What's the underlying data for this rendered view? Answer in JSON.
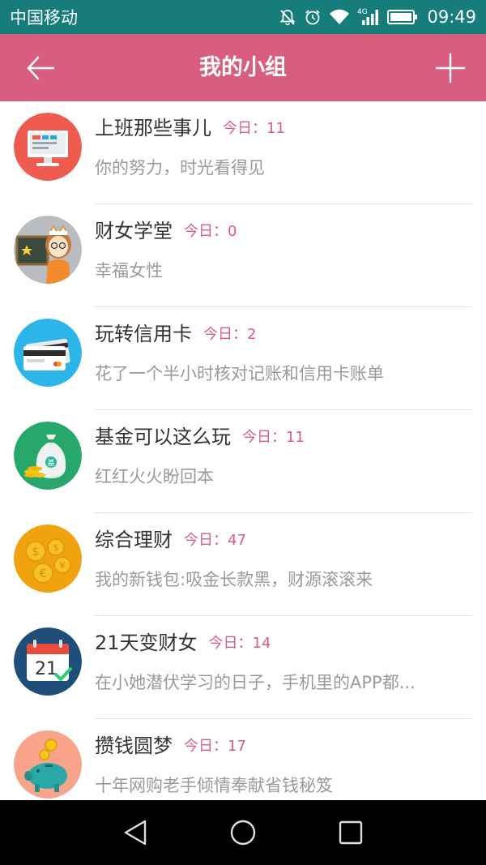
{
  "status_bar": {
    "carrier": "中国移动",
    "network": "4G",
    "time": "09:49",
    "icons": [
      "mute-icon",
      "alarm-icon",
      "wifi-icon",
      "signal-icon",
      "battery-icon"
    ]
  },
  "header": {
    "title": "我的小组",
    "back_icon": "arrow-left-icon",
    "add_icon": "plus-icon",
    "color": "#d95d7e"
  },
  "groups": [
    {
      "name": "上班那些事儿",
      "today": "今日：11",
      "desc": "你的努力，时光看得见",
      "icon": "monitor-icon"
    },
    {
      "name": "财女学堂",
      "today": "今日：0",
      "desc": "幸福女性",
      "icon": "teacher-girl-icon"
    },
    {
      "name": "玩转信用卡",
      "today": "今日：2",
      "desc": "花了一个半小时核对记账和信用卡账单",
      "icon": "credit-card-icon"
    },
    {
      "name": "基金可以这么玩",
      "today": "今日：11",
      "desc": "红红火火盼回本",
      "icon": "fund-bag-icon"
    },
    {
      "name": "综合理财",
      "today": "今日：47",
      "desc": "我的新钱包:吸金长款黑，财源滚滚来",
      "icon": "coins-icon"
    },
    {
      "name": "21天变财女",
      "today": "今日：14",
      "desc": "在小她潜伏学习的日子，手机里的APP都...",
      "icon": "calendar-21-icon"
    },
    {
      "name": "攒钱圆梦",
      "today": "今日：17",
      "desc": "十年网购老手倾情奉献省钱秘笈",
      "icon": "piggy-bank-icon"
    }
  ],
  "nav_bar": {
    "back": "triangle-back-icon",
    "home": "circle-home-icon",
    "recents": "square-recents-icon"
  }
}
